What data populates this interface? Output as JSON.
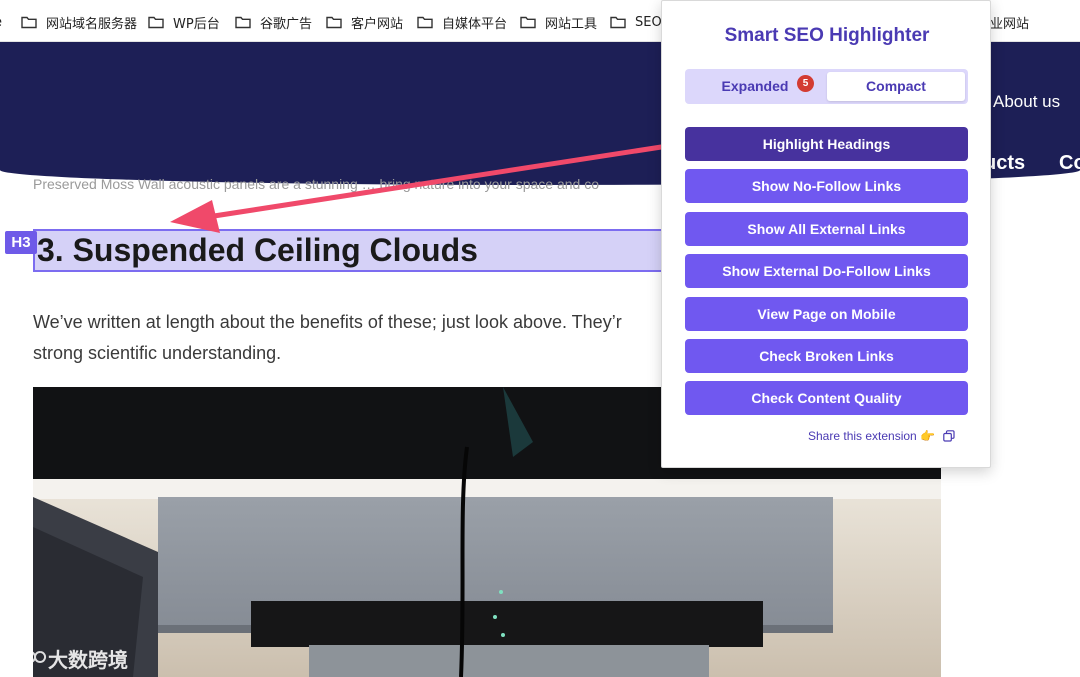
{
  "bookmarks": [
    {
      "label": "网站域名服务器"
    },
    {
      "label": "WP后台"
    },
    {
      "label": "谷歌广告"
    },
    {
      "label": "客户网站"
    },
    {
      "label": "自媒体平台"
    },
    {
      "label": "网站工具"
    },
    {
      "label": "SEO"
    }
  ],
  "bookmark_tail": "业网站",
  "site": {
    "nav_about": "About us",
    "nav_products": "ucts",
    "nav_co": "Co",
    "faded_line": "Preserved Moss Wall acoustic panels are a stunning … bring nature into your space and co",
    "heading_tag": "H3",
    "heading": "3. Suspended Ceiling Clouds",
    "paragraph_line1": "We’ve written at length about the benefits of these; just look above. They’r",
    "paragraph_line2": "strong scientific understanding."
  },
  "popup": {
    "title": "Smart SEO Highlighter",
    "toggle": {
      "expanded": "Expanded",
      "badge": "5",
      "compact": "Compact"
    },
    "buttons": [
      {
        "label": "Highlight Headings",
        "active": true
      },
      {
        "label": "Show No-Follow Links"
      },
      {
        "label": "Show All External Links"
      },
      {
        "label": "Show External Do-Follow Links"
      },
      {
        "label": "View Page on Mobile"
      },
      {
        "label": "Check Broken Links"
      },
      {
        "label": "Check Content Quality"
      }
    ],
    "share": "Share this extension 👉"
  },
  "watermark": "大数跨境",
  "colors": {
    "header_bg": "#1d1f56",
    "accent": "#7058f0",
    "accent_active": "#47329e",
    "highlight_bg": "#d5d1f7",
    "arrow": "#f0496a",
    "badge": "#d33b32"
  },
  "icons": [
    "folder-icon",
    "copy-icon",
    "pointing-hand-icon"
  ]
}
